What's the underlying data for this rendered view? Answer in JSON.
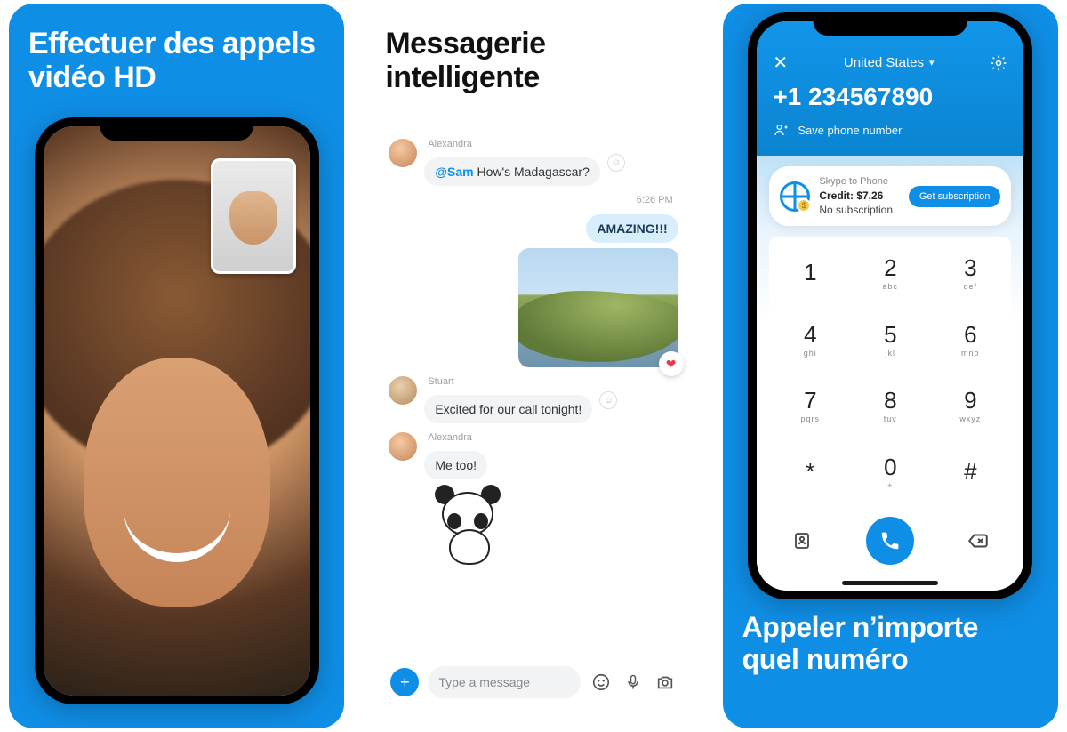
{
  "card1": {
    "title": "Effectuer des appels vidéo HD"
  },
  "card2": {
    "title": "Messagerie intelligente",
    "messages": {
      "m1": {
        "sender": "Alexandra",
        "mention": "@Sam",
        "text": " How's Madagascar?"
      },
      "timestamp": "6:26 PM",
      "m2": {
        "text": "AMAZING!!!"
      },
      "m3": {
        "sender": "Stuart",
        "text": "Excited for our call tonight!"
      },
      "m4": {
        "sender": "Alexandra",
        "text": "Me too!"
      }
    },
    "composer": {
      "placeholder": "Type a message"
    }
  },
  "card3": {
    "top": {
      "country": "United States",
      "phone": "+1 234567890",
      "save": "Save phone number"
    },
    "credit": {
      "line1": "Skype to Phone",
      "line2": "Credit: $7,26",
      "line3": "No subscription",
      "cta": "Get subscription"
    },
    "keys": [
      {
        "d": "1",
        "s": ""
      },
      {
        "d": "2",
        "s": "abc"
      },
      {
        "d": "3",
        "s": "def"
      },
      {
        "d": "4",
        "s": "ghi"
      },
      {
        "d": "5",
        "s": "jkl"
      },
      {
        "d": "6",
        "s": "mno"
      },
      {
        "d": "7",
        "s": "pqrs"
      },
      {
        "d": "8",
        "s": "tuv"
      },
      {
        "d": "9",
        "s": "wxyz"
      },
      {
        "d": "*",
        "s": ""
      },
      {
        "d": "0",
        "s": "+"
      },
      {
        "d": "#",
        "s": ""
      }
    ],
    "title": "Appeler n’importe quel numéro"
  }
}
